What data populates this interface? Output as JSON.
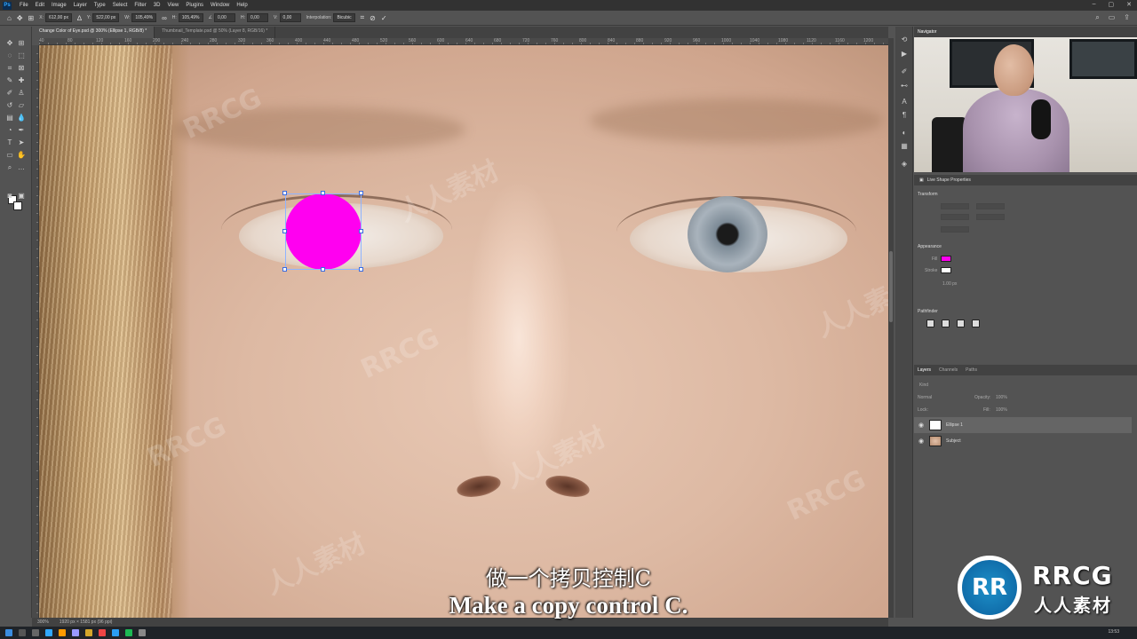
{
  "menubar": {
    "logo": "Ps",
    "items": [
      "File",
      "Edit",
      "Image",
      "Layer",
      "Type",
      "Select",
      "Filter",
      "3D",
      "View",
      "Plugins",
      "Window",
      "Help"
    ]
  },
  "options": {
    "x_label": "X:",
    "x_value": "612,00 px",
    "y_label": "Y:",
    "y_value": "522,00 px",
    "w_label": "W:",
    "w_value": "105,49%",
    "h_label": "H:",
    "h_value": "105,49%",
    "angle_value": "0,00",
    "hskew_label": "H:",
    "hskew_value": "0,00",
    "vskew_label": "V:",
    "vskew_value": "0,00",
    "interp_label": "Interpolation:",
    "interp_value": "Bicubic"
  },
  "tabs": [
    "Change Color of Eye.psd @ 300% (Ellipse 1, RGB/8) *",
    "Thumbnail_Template.psd @ 50% (Layer 8, RGB/16) *"
  ],
  "ruler_marks": [
    "40",
    "60",
    "80",
    "100",
    "120",
    "140",
    "160",
    "180",
    "200",
    "220",
    "240",
    "260",
    "280",
    "300",
    "320",
    "340",
    "360",
    "380",
    "400",
    "420",
    "440",
    "460",
    "480",
    "500",
    "520",
    "540",
    "560",
    "580",
    "600",
    "620",
    "640",
    "660",
    "680",
    "700",
    "720",
    "740",
    "760",
    "780",
    "800",
    "820",
    "840",
    "860",
    "880",
    "900",
    "920",
    "940",
    "960",
    "980",
    "1000",
    "1020",
    "1040",
    "1060",
    "1080",
    "1100",
    "1120",
    "1140",
    "1160",
    "1180",
    "1200",
    "1220"
  ],
  "status": {
    "zoom": "300%",
    "doc_size": "1920 px × 1581 px (96 ppi)"
  },
  "navigator": {
    "title": "Navigator"
  },
  "properties": {
    "title": "Live Shape Properties",
    "transform_label": "Transform",
    "appearance_label": "Appearance",
    "fill_label": "Fill",
    "stroke_label": "Stroke",
    "stroke_width": "1.00 px",
    "pathfinder_label": "Pathfinder",
    "fill_color": "#ff00f0"
  },
  "layers": {
    "tabs": [
      "Layers",
      "Channels",
      "Paths"
    ],
    "search_placeholder": "Kind",
    "blend_mode": "Normal",
    "opacity_label": "Opacity:",
    "opacity_value": "100%",
    "lock_label": "Lock:",
    "fill_label": "Fill:",
    "fill_value": "100%",
    "items": [
      {
        "name": "Ellipse 1",
        "type": "shape",
        "selected": true
      },
      {
        "name": "Subject",
        "type": "image",
        "selected": false
      }
    ]
  },
  "subtitles": {
    "cn": "做一个拷贝控制C",
    "en": "Make a copy control C."
  },
  "watermark": {
    "text": "RRCG",
    "text_cn": "人人素材"
  },
  "brand": {
    "logo_letters": "RR",
    "name": "RRCG",
    "sub": "人人素材"
  },
  "taskbar": {
    "time": "13:53"
  },
  "colors": {
    "accent": "#31a8ff",
    "ellipse": "#ff00f0"
  }
}
